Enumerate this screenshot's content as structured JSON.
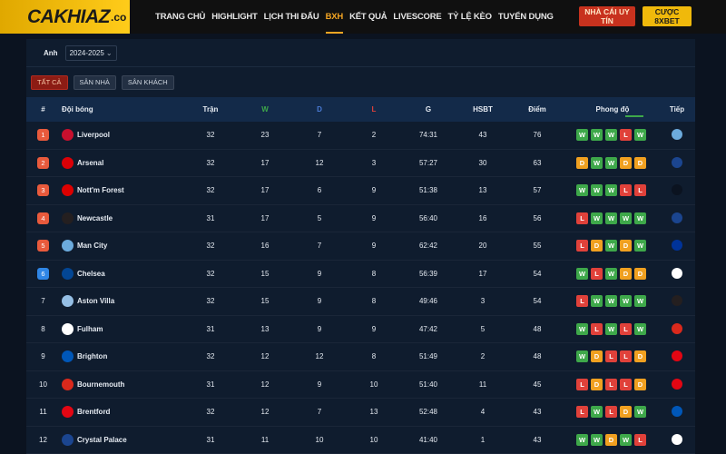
{
  "header": {
    "logo_main": "CAKHIAZ",
    "logo_suffix": ".co",
    "nav": [
      {
        "label": "TRANG CHỦ",
        "active": false
      },
      {
        "label": "HIGHLIGHT",
        "active": false
      },
      {
        "label": "LỊCH THI ĐẤU",
        "active": false
      },
      {
        "label": "BXH",
        "active": true
      },
      {
        "label": "KẾT QUẢ",
        "active": false
      },
      {
        "label": "LIVESCORE",
        "active": false
      },
      {
        "label": "TỶ LỆ KÈO",
        "active": false
      },
      {
        "label": "TUYỂN DỤNG",
        "active": false
      }
    ],
    "btn_red": "NHÀ CÁI UY TÍN",
    "btn_yellow": "CƯỢC 8XBET"
  },
  "filter": {
    "league": "Anh",
    "season": "2024-2025"
  },
  "tabs": [
    "TẤT CẢ",
    "SÂN NHÀ",
    "SÂN KHÁCH"
  ],
  "columns": {
    "rank": "#",
    "team": "Đội bóng",
    "played": "Trận",
    "w": "W",
    "d": "D",
    "l": "L",
    "goals": "G",
    "gd": "HSBT",
    "pts": "Điểm",
    "form": "Phong độ",
    "next": "Tiếp"
  },
  "colors": {
    "w_col": "#3ea84a",
    "d_col": "#4a7bd6",
    "l_col": "#e0413a",
    "top4": "#e85a3c",
    "europa": "#2f86e6",
    "accent": "#f5a623"
  },
  "rows": [
    {
      "rank": "1",
      "zone": "top4",
      "team": "Liverpool",
      "crest": "#c8102e",
      "played": "32",
      "w": "23",
      "d": "7",
      "l": "2",
      "goals": "74:31",
      "gd": "43",
      "pts": "76",
      "form": [
        "W",
        "W",
        "W",
        "L",
        "W"
      ],
      "next": "#6cabdd"
    },
    {
      "rank": "2",
      "zone": "top4",
      "team": "Arsenal",
      "crest": "#db0007",
      "played": "32",
      "w": "17",
      "d": "12",
      "l": "3",
      "goals": "57:27",
      "gd": "30",
      "pts": "63",
      "form": [
        "D",
        "W",
        "W",
        "D",
        "D"
      ],
      "next": "#1b458f"
    },
    {
      "rank": "3",
      "zone": "top4",
      "team": "Nott'm Forest",
      "crest": "#dd0000",
      "played": "32",
      "w": "17",
      "d": "6",
      "l": "9",
      "goals": "51:38",
      "gd": "13",
      "pts": "57",
      "form": [
        "W",
        "W",
        "W",
        "L",
        "L"
      ],
      "next": "#0b1320"
    },
    {
      "rank": "4",
      "zone": "top4",
      "team": "Newcastle",
      "crest": "#241f20",
      "played": "31",
      "w": "17",
      "d": "5",
      "l": "9",
      "goals": "56:40",
      "gd": "16",
      "pts": "56",
      "form": [
        "L",
        "W",
        "W",
        "W",
        "W"
      ],
      "next": "#1b458f"
    },
    {
      "rank": "5",
      "zone": "top4",
      "team": "Man City",
      "crest": "#6cabdd",
      "played": "32",
      "w": "16",
      "d": "7",
      "l": "9",
      "goals": "62:42",
      "gd": "20",
      "pts": "55",
      "form": [
        "L",
        "D",
        "W",
        "D",
        "W"
      ],
      "next": "#003399"
    },
    {
      "rank": "6",
      "zone": "europa",
      "team": "Chelsea",
      "crest": "#034694",
      "played": "32",
      "w": "15",
      "d": "9",
      "l": "8",
      "goals": "56:39",
      "gd": "17",
      "pts": "54",
      "form": [
        "W",
        "L",
        "W",
        "D",
        "D"
      ],
      "next": "#ffffff"
    },
    {
      "rank": "7",
      "zone": "none",
      "team": "Aston Villa",
      "crest": "#95bfe5",
      "played": "32",
      "w": "15",
      "d": "9",
      "l": "8",
      "goals": "49:46",
      "gd": "3",
      "pts": "54",
      "form": [
        "L",
        "W",
        "W",
        "W",
        "W"
      ],
      "next": "#241f20"
    },
    {
      "rank": "8",
      "zone": "none",
      "team": "Fulham",
      "crest": "#ffffff",
      "played": "31",
      "w": "13",
      "d": "9",
      "l": "9",
      "goals": "47:42",
      "gd": "5",
      "pts": "48",
      "form": [
        "W",
        "L",
        "W",
        "L",
        "W"
      ],
      "next": "#da291c"
    },
    {
      "rank": "9",
      "zone": "none",
      "team": "Brighton",
      "crest": "#0057b8",
      "played": "32",
      "w": "12",
      "d": "12",
      "l": "8",
      "goals": "51:49",
      "gd": "2",
      "pts": "48",
      "form": [
        "W",
        "D",
        "L",
        "L",
        "D"
      ],
      "next": "#e30613"
    },
    {
      "rank": "10",
      "zone": "none",
      "team": "Bournemouth",
      "crest": "#da291c",
      "played": "31",
      "w": "12",
      "d": "9",
      "l": "10",
      "goals": "51:40",
      "gd": "11",
      "pts": "45",
      "form": [
        "L",
        "D",
        "L",
        "L",
        "D"
      ],
      "next": "#e30613"
    },
    {
      "rank": "11",
      "zone": "none",
      "team": "Brentford",
      "crest": "#e30613",
      "played": "32",
      "w": "12",
      "d": "7",
      "l": "13",
      "goals": "52:48",
      "gd": "4",
      "pts": "43",
      "form": [
        "L",
        "W",
        "L",
        "D",
        "W"
      ],
      "next": "#0057b8"
    },
    {
      "rank": "12",
      "zone": "none",
      "team": "Crystal Palace",
      "crest": "#1b458f",
      "played": "31",
      "w": "11",
      "d": "10",
      "l": "10",
      "goals": "41:40",
      "gd": "1",
      "pts": "43",
      "form": [
        "W",
        "W",
        "D",
        "W",
        "L"
      ],
      "next": "#ffffff"
    }
  ]
}
